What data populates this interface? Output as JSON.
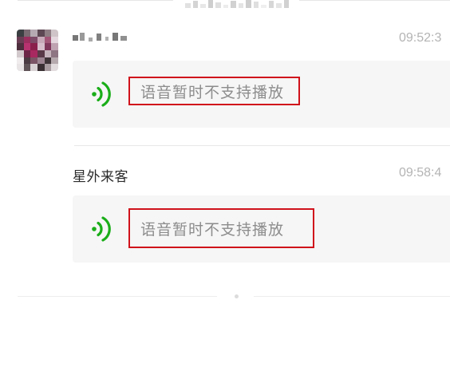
{
  "colors": {
    "accent_green": "#1aad19",
    "highlight_red": "#d0121b",
    "bubble_bg": "#f6f6f6",
    "time_text": "#b4b4b4"
  },
  "messages": [
    {
      "sender": "",
      "sender_obscured": true,
      "time": "09:52:3",
      "voice_icon": "voice-wave-icon",
      "notice": "语音暂时不支持播放"
    },
    {
      "sender": "星外来客",
      "sender_obscured": false,
      "time": "09:58:4",
      "voice_icon": "voice-wave-icon",
      "notice": "语音暂时不支持播放"
    }
  ]
}
